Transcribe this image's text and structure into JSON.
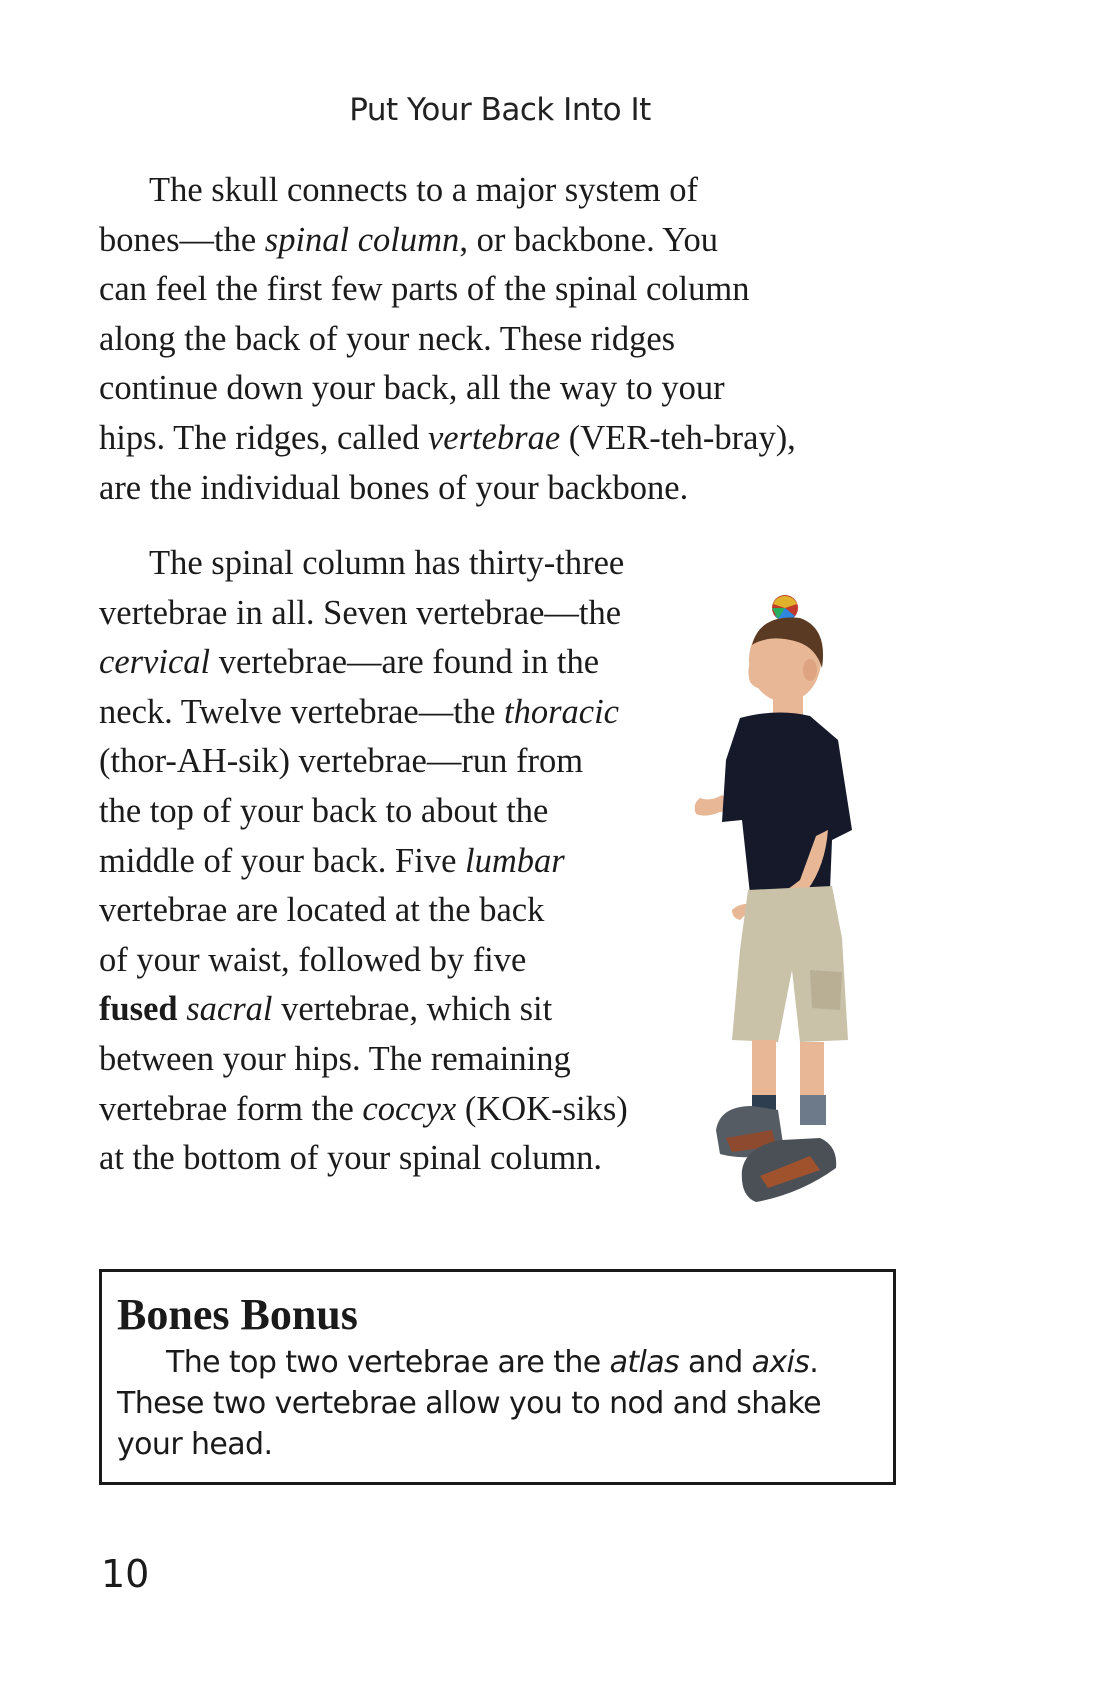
{
  "page": {
    "running_head": "Put Your Back Into It",
    "page_number": "10"
  },
  "paragraph1": {
    "l1": "The skull connects to a major system of",
    "l2a": "bones—the ",
    "l2b": "spinal column",
    "l2c": ", or backbone. You",
    "l3": "can feel the first few parts of the spinal column",
    "l4": "along the back of your neck. These ridges",
    "l5": "continue down your back, all the way to your",
    "l6a": "hips. The ridges, called ",
    "l6b": "vertebrae",
    "l6c": " (VER-teh-bray),",
    "l7": "are the individual bones of your backbone."
  },
  "paragraph2": {
    "l1": "The spinal column has thirty-three",
    "l2": "vertebrae in all. Seven vertebrae—the",
    "l3a": "cervical",
    "l3b": " vertebrae—are found in the",
    "l4a": "neck. Twelve vertebrae—the ",
    "l4b": "thoracic",
    "l5": "(thor-AH-sik) vertebrae—run from",
    "l6": "the top of your back to about the",
    "l7a": "middle of your back. Five ",
    "l7b": "lumbar",
    "l8": "vertebrae are located at the back",
    "l9": "of your waist, followed by five",
    "l10a": "fused",
    "l10b": " ",
    "l10c": "sacral",
    "l10d": " vertebrae, which sit",
    "l11": "between your hips. The remaining",
    "l12a": "vertebrae form the ",
    "l12b": "coccyx",
    "l12c": " (KOK-siks)",
    "l13": "at the bottom of your spinal column."
  },
  "sidebar": {
    "title": "Bones Bonus",
    "l1a": "The top two vertebrae are the ",
    "l1b": "atlas",
    "l1c": " and ",
    "l1d": "axis",
    "l1e": ".",
    "l2": "These two vertebrae allow you to nod and shake",
    "l3": "your head."
  },
  "colors": {
    "text": "#1a1a1a",
    "shirt": "#15192a",
    "shorts": "#c9c1a8",
    "skin": "#e8b796",
    "hair": "#5a3a22"
  }
}
